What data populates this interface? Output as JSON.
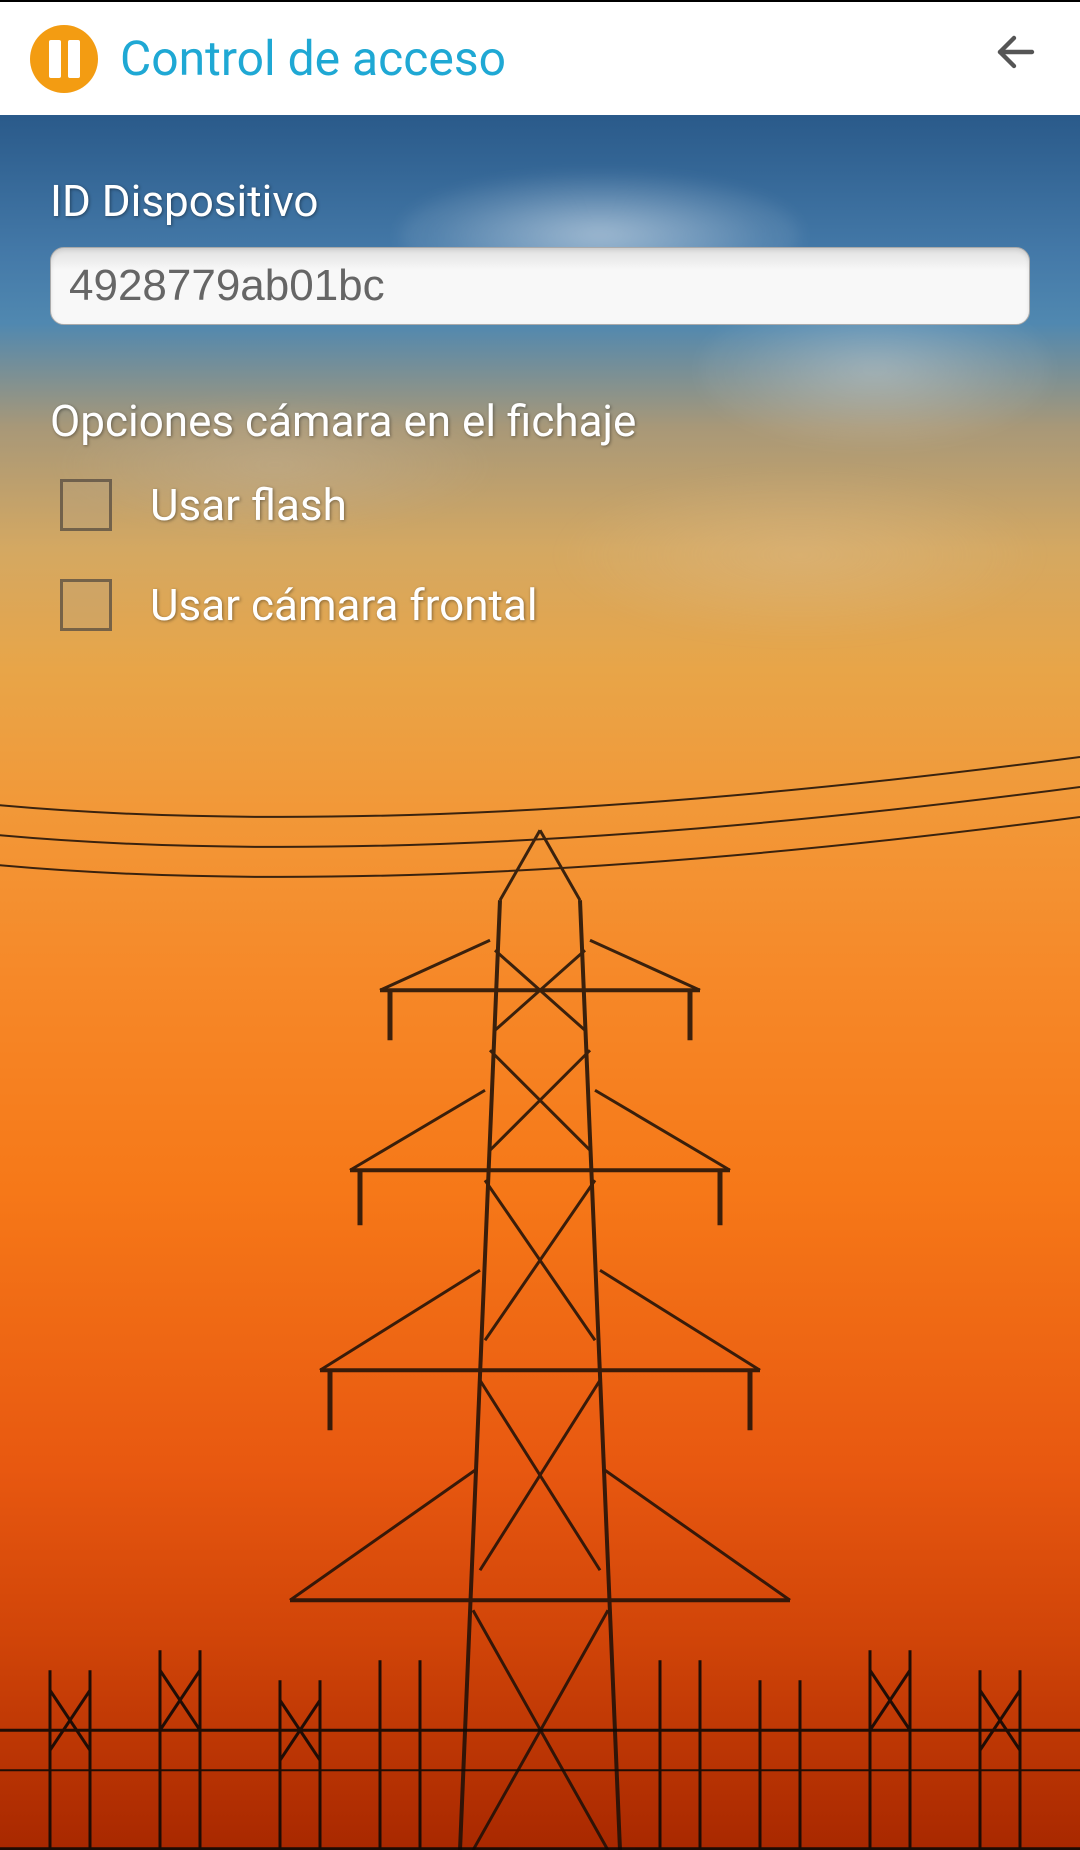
{
  "header": {
    "title": "Control de acceso"
  },
  "form": {
    "device_id_label": "ID Dispositivo",
    "device_id_value": "4928779ab01bc",
    "camera_options_label": "Opciones cámara en el fichaje",
    "use_flash_label": "Usar flash",
    "use_front_camera_label": "Usar cámara frontal"
  }
}
